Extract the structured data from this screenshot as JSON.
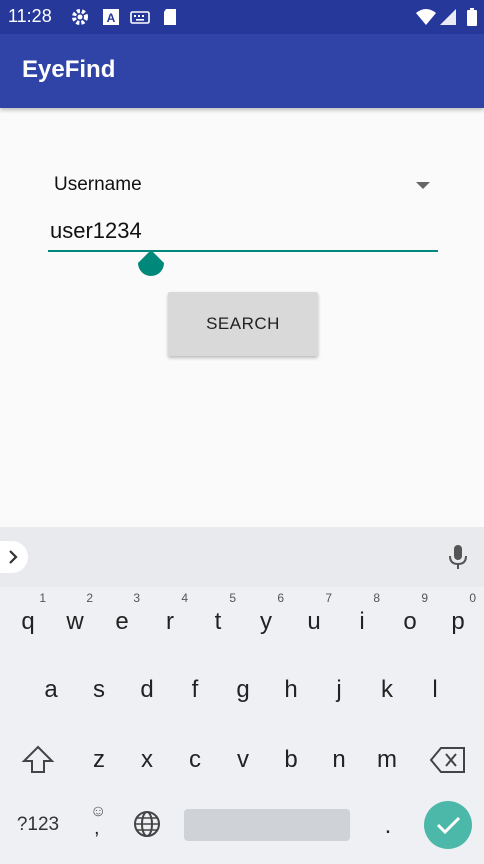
{
  "status_bar": {
    "time": "11:28",
    "icons": [
      "settings-icon",
      "a-app-icon",
      "keyboard-icon",
      "sd-card-icon",
      "wifi-icon",
      "signal-icon",
      "battery-icon"
    ]
  },
  "app_bar": {
    "title": "EyeFind"
  },
  "form": {
    "spinner_value": "Username",
    "input_value": "user1234",
    "search_label": "SEARCH"
  },
  "colors": {
    "status_bar": "#26399b",
    "app_bar": "#2f44a6",
    "accent": "#00897b",
    "keyboard_bg": "#eef0f3",
    "done_key": "#4bb8aa"
  },
  "keyboard": {
    "row1": [
      {
        "k": "q",
        "h": "1"
      },
      {
        "k": "w",
        "h": "2"
      },
      {
        "k": "e",
        "h": "3"
      },
      {
        "k": "r",
        "h": "4"
      },
      {
        "k": "t",
        "h": "5"
      },
      {
        "k": "y",
        "h": "6"
      },
      {
        "k": "u",
        "h": "7"
      },
      {
        "k": "i",
        "h": "8"
      },
      {
        "k": "o",
        "h": "9"
      },
      {
        "k": "p",
        "h": "0"
      }
    ],
    "row2": [
      "a",
      "s",
      "d",
      "f",
      "g",
      "h",
      "j",
      "k",
      "l"
    ],
    "row3": [
      "z",
      "x",
      "c",
      "v",
      "b",
      "n",
      "m"
    ],
    "sym_label": "?123",
    "emoji_label": "☺",
    "comma_label": ",",
    "period_label": "."
  }
}
